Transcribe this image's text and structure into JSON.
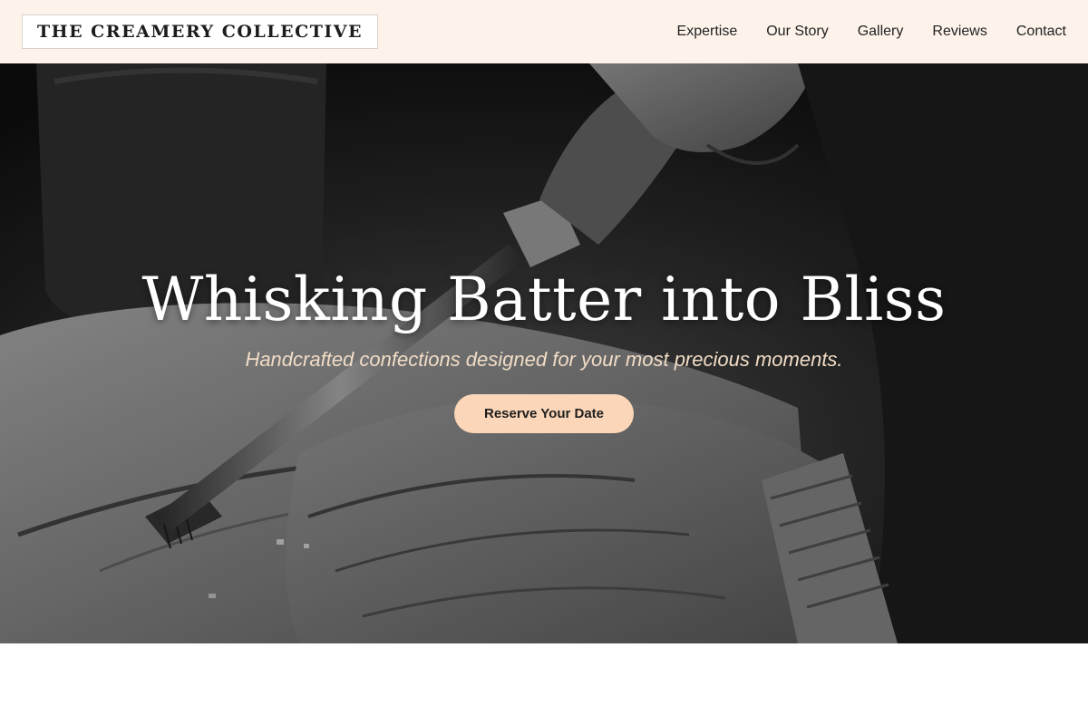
{
  "header": {
    "logo": "THE CREAMERY COLLECTIVE",
    "nav": [
      "Expertise",
      "Our Story",
      "Gallery",
      "Reviews",
      "Contact"
    ]
  },
  "hero": {
    "title": "Whisking Batter into Bliss",
    "subtitle": "Handcrafted confections designed for your most precious moments.",
    "cta": "Reserve Your Date",
    "image": "black-and-white photo of hands carving wood with a chisel"
  },
  "next_section": {
    "heading": ""
  },
  "colors": {
    "header_bg": "#fdf3ea",
    "cta_bg": "#fbd6b8",
    "subtitle": "#f1dcc6",
    "text_dark": "#1c1c1c"
  }
}
